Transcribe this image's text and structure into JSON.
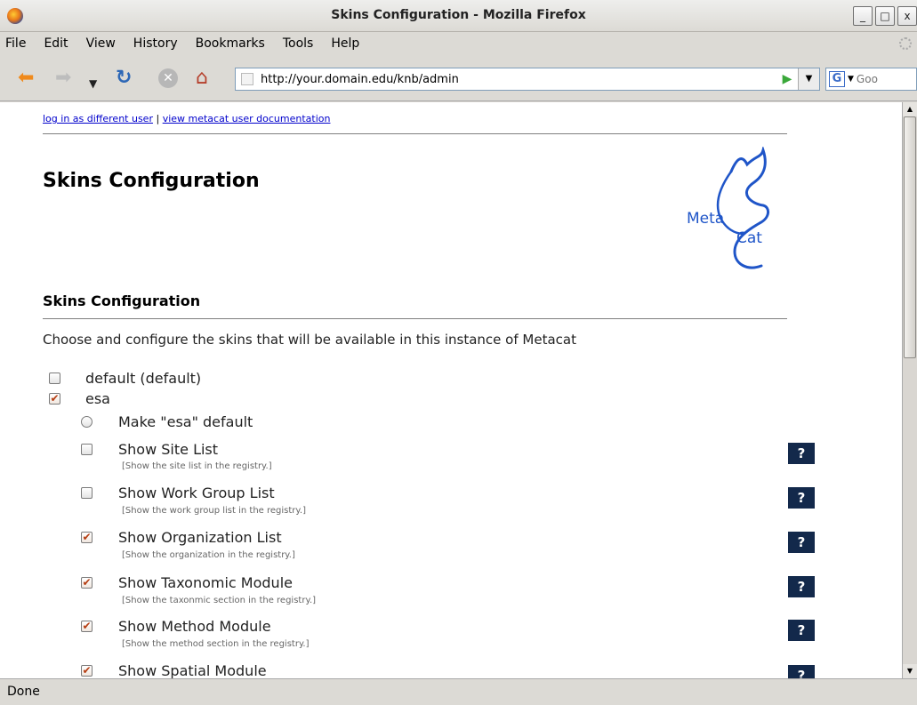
{
  "window": {
    "title": "Skins Configuration - Mozilla Firefox",
    "controls": [
      "_",
      "□",
      "x"
    ]
  },
  "menu": [
    "File",
    "Edit",
    "View",
    "History",
    "Bookmarks",
    "Tools",
    "Help"
  ],
  "toolbar": {
    "url": "http://your.domain.edu/knb/admin",
    "search_placeholder": "Goo",
    "search_engine": "G"
  },
  "page": {
    "links": {
      "login": "log in as different user",
      "separator": "|",
      "docs": "view metacat user documentation"
    },
    "title": "Skins Configuration",
    "section_title": "Skins Configuration",
    "intro": "Choose and configure the skins that will be available in this instance of Metacat",
    "logo": {
      "line1": "Meta",
      "line2": "Cat",
      "color": "#1f55c8"
    },
    "skins": [
      {
        "label": "default (default)",
        "checked": false
      },
      {
        "label": "esa",
        "checked": true
      }
    ],
    "make_default": "Make \"esa\" default",
    "options": [
      {
        "label": "Show Site List",
        "desc": "[Show the site list in the registry.]",
        "checked": false
      },
      {
        "label": "Show Work Group List",
        "desc": "[Show the work group list in the registry.]",
        "checked": false
      },
      {
        "label": "Show Organization List",
        "desc": "[Show the organization in the registry.]",
        "checked": true
      },
      {
        "label": "Show Taxonomic Module",
        "desc": "[Show the taxonmic section in the registry.]",
        "checked": true
      },
      {
        "label": "Show Method Module",
        "desc": "[Show the method section in the registry.]",
        "checked": true
      },
      {
        "label": "Show Spatial Module",
        "desc": "",
        "checked": true
      }
    ],
    "help_label": "?"
  },
  "status": "Done",
  "colors": {
    "check": "#b53d12",
    "help_bg": "#13294b",
    "link": "#0000cc"
  }
}
